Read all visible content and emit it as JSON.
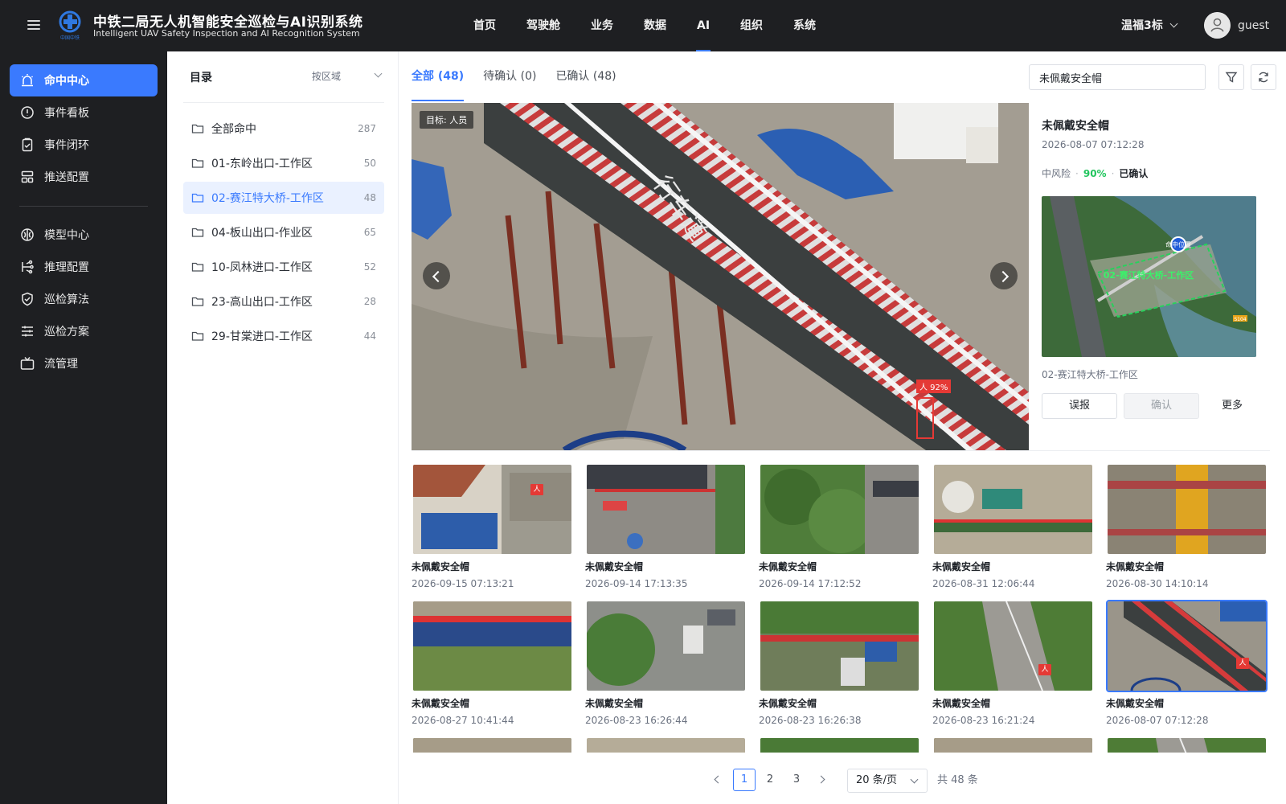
{
  "header": {
    "title": "中铁二局无人机智能安全巡检与AI识别系统",
    "subtitle": "Intelligent UAV Safety Inspection and AI Recognition System",
    "logo_text": "中国中铁",
    "nav": [
      "首页",
      "驾驶舱",
      "业务",
      "数据",
      "AI",
      "组织",
      "系统"
    ],
    "active_nav": "AI",
    "project": "温福3标",
    "user": "guest"
  },
  "sidebar": {
    "items": [
      {
        "label": "命中中心",
        "icon": "alarm-icon",
        "active": true
      },
      {
        "label": "事件看板",
        "icon": "alert-circle-icon"
      },
      {
        "label": "事件闭环",
        "icon": "clipboard-check-icon"
      },
      {
        "label": "推送配置",
        "icon": "layout-icon"
      },
      {
        "label": "模型中心",
        "icon": "brain-icon"
      },
      {
        "label": "推理配置",
        "icon": "inference-icon"
      },
      {
        "label": "巡检算法",
        "icon": "shield-icon"
      },
      {
        "label": "巡检方案",
        "icon": "sliders-icon"
      },
      {
        "label": "流管理",
        "icon": "tv-icon"
      }
    ]
  },
  "directory": {
    "title": "目录",
    "filter": "按区域",
    "items": [
      {
        "label": "全部命中",
        "count": "287"
      },
      {
        "label": "01-东岭出口-工作区",
        "count": "50"
      },
      {
        "label": "02-赛江特大桥-工作区",
        "count": "48",
        "active": true
      },
      {
        "label": "04-板山出口-作业区",
        "count": "65"
      },
      {
        "label": "10-凤林进口-工作区",
        "count": "52"
      },
      {
        "label": "23-高山出口-工作区",
        "count": "28"
      },
      {
        "label": "29-甘棠进口-工作区",
        "count": "44"
      }
    ]
  },
  "tabs": [
    {
      "label": "全部 (48)",
      "active": true
    },
    {
      "label": "待确认 (0)"
    },
    {
      "label": "已确认 (48)"
    }
  ],
  "search": {
    "value": "未佩戴安全帽"
  },
  "viewer": {
    "target_tag": "目标: 人员",
    "road_text": "行车道",
    "detection_label": "人 92%"
  },
  "detail": {
    "title": "未佩戴安全帽",
    "time": "2026-08-07 07:12:28",
    "risk": "中风险",
    "confidence": "90%",
    "status": "已确认",
    "map_label": "02-赛江特大桥-工作区",
    "map_marker": "命中位置",
    "map_road_tag": "S104",
    "zone": "02-赛江特大桥-工作区",
    "btn_report": "误报",
    "btn_confirm": "确认",
    "btn_more": "更多"
  },
  "thumbnails": [
    {
      "title": "未佩戴安全帽",
      "time": "2026-09-15 07:13:21",
      "scene": "building",
      "person": true
    },
    {
      "title": "未佩戴安全帽",
      "time": "2026-09-14 17:13:35",
      "scene": "station"
    },
    {
      "title": "未佩戴安全帽",
      "time": "2026-09-14 17:12:52",
      "scene": "trees"
    },
    {
      "title": "未佩戴安全帽",
      "time": "2026-08-31 12:06:44",
      "scene": "bridge-site"
    },
    {
      "title": "未佩戴安全帽",
      "time": "2026-08-30 14:10:14",
      "scene": "tower"
    },
    {
      "title": "未佩戴安全帽",
      "time": "2026-08-27 10:41:44",
      "scene": "fence"
    },
    {
      "title": "未佩戴安全帽",
      "time": "2026-08-23 16:26:44",
      "scene": "cars"
    },
    {
      "title": "未佩戴安全帽",
      "time": "2026-08-23 16:26:38",
      "scene": "gate"
    },
    {
      "title": "未佩戴安全帽",
      "time": "2026-08-23 16:21:24",
      "scene": "road",
      "person": true
    },
    {
      "title": "未佩戴安全帽",
      "time": "2026-08-07 07:12:28",
      "scene": "bridge",
      "person": true,
      "selected": true
    },
    {
      "title": "",
      "time": "",
      "scene": "fence"
    },
    {
      "title": "",
      "time": "",
      "scene": "bridge-site"
    },
    {
      "title": "",
      "time": "",
      "scene": "gate"
    },
    {
      "title": "",
      "time": "",
      "scene": "fence"
    },
    {
      "title": "",
      "time": "",
      "scene": "road"
    }
  ],
  "pagination": {
    "pages": [
      "1",
      "2",
      "3"
    ],
    "current": "1",
    "page_size": "20 条/页",
    "total": "共 48 条"
  },
  "colors": {
    "accent": "#3a7afe",
    "topbar": "#1e1f22",
    "success": "#22c55e",
    "alert": "#e53935"
  }
}
